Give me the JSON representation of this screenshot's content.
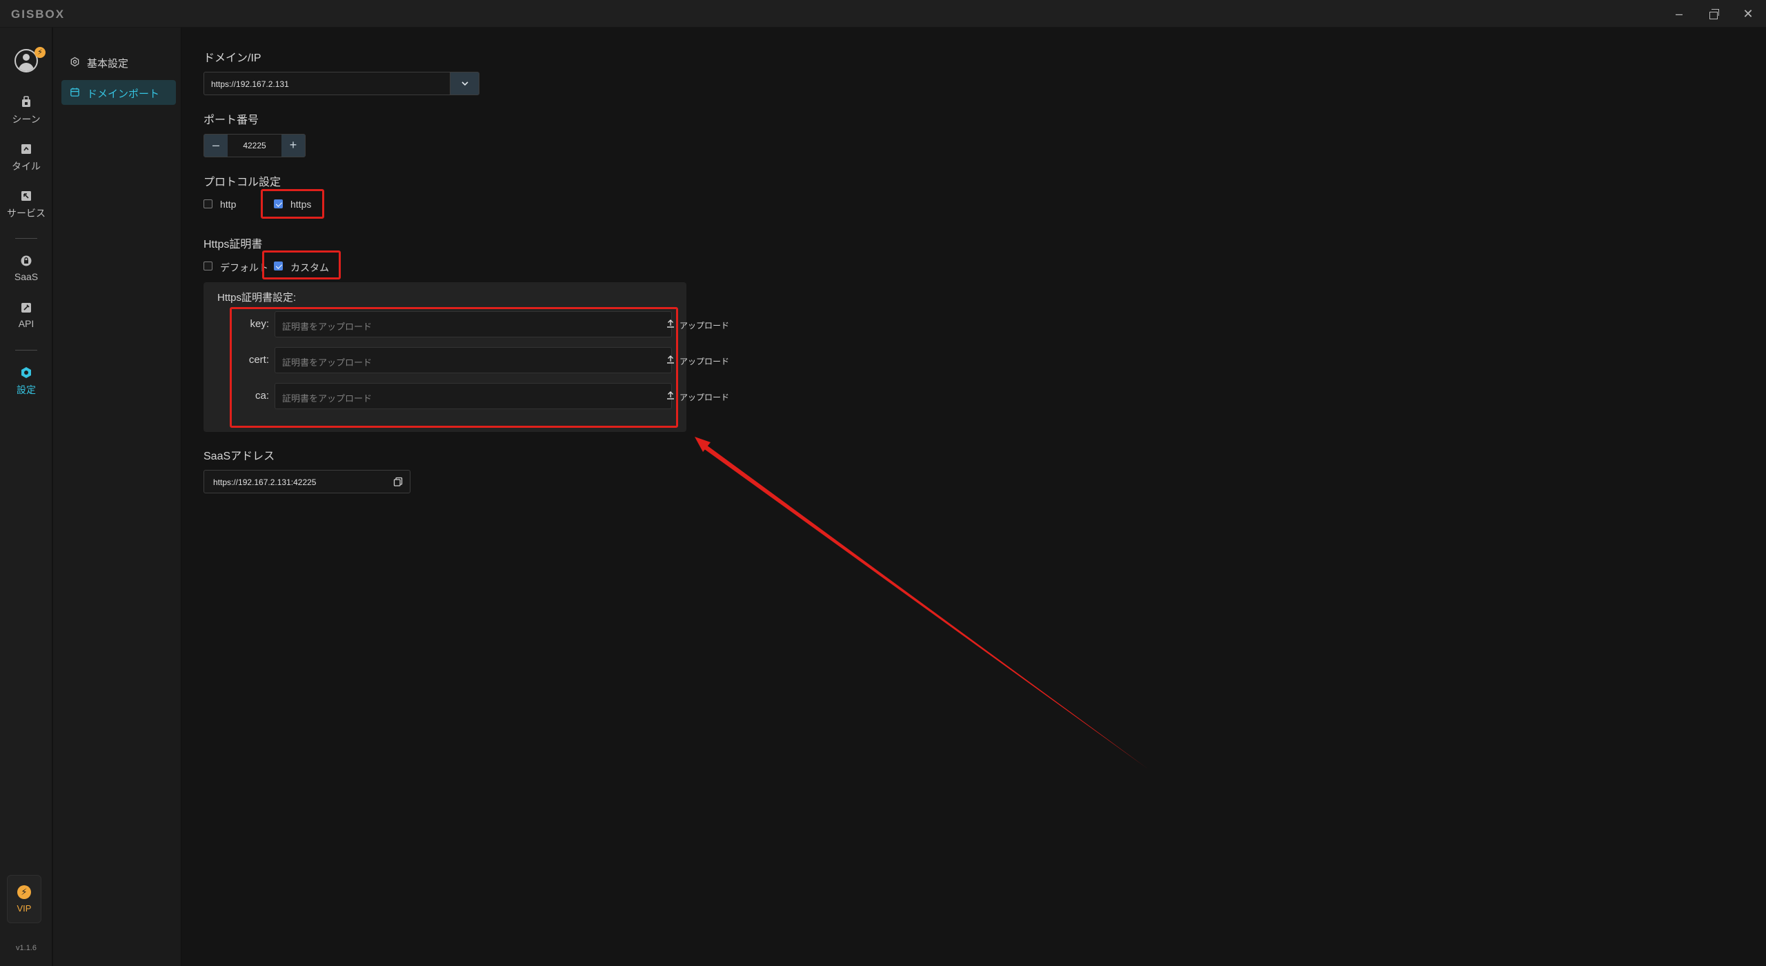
{
  "app": {
    "logo": "GISBOX",
    "version": "v1.1.6"
  },
  "rail": {
    "items": [
      {
        "label": "シーン",
        "icon": "scene-icon"
      },
      {
        "label": "タイル",
        "icon": "tile-icon"
      },
      {
        "label": "サービス",
        "icon": "service-icon"
      },
      {
        "label": "SaaS",
        "icon": "saas-icon"
      },
      {
        "label": "API",
        "icon": "api-icon"
      },
      {
        "label": "設定",
        "icon": "settings-icon",
        "active": true
      }
    ],
    "vip_label": "VIP"
  },
  "subnav": {
    "items": [
      {
        "label": "基本設定",
        "icon": "gear-icon"
      },
      {
        "label": "ドメインポート",
        "icon": "calendar-icon",
        "active": true
      }
    ]
  },
  "main": {
    "domain": {
      "title": "ドメイン/IP",
      "value": "https://192.167.2.131"
    },
    "port": {
      "title": "ポート番号",
      "value": "42225"
    },
    "protocol": {
      "title": "プロトコル設定",
      "options": [
        {
          "label": "http",
          "checked": false
        },
        {
          "label": "https",
          "checked": true
        }
      ]
    },
    "https_cert": {
      "title": "Https証明書",
      "options": [
        {
          "label": "デフォルト",
          "checked": false
        },
        {
          "label": "カスタム",
          "checked": true
        }
      ]
    },
    "cert_settings": {
      "title": "Https証明書設定:",
      "rows": [
        {
          "label": "key:",
          "placeholder": "証明書をアップロード",
          "button": "アップロード"
        },
        {
          "label": "cert:",
          "placeholder": "証明書をアップロード",
          "button": "アップロード"
        },
        {
          "label": "ca:",
          "placeholder": "証明書をアップロード",
          "button": "アップロード"
        }
      ]
    },
    "saas": {
      "title": "SaaSアドレス",
      "value": "https://192.167.2.131:42225"
    }
  },
  "colors": {
    "accent": "#36c3e0",
    "checkbox": "#4f86e6",
    "annotation": "#e0201b",
    "vip": "#f2a83b"
  }
}
